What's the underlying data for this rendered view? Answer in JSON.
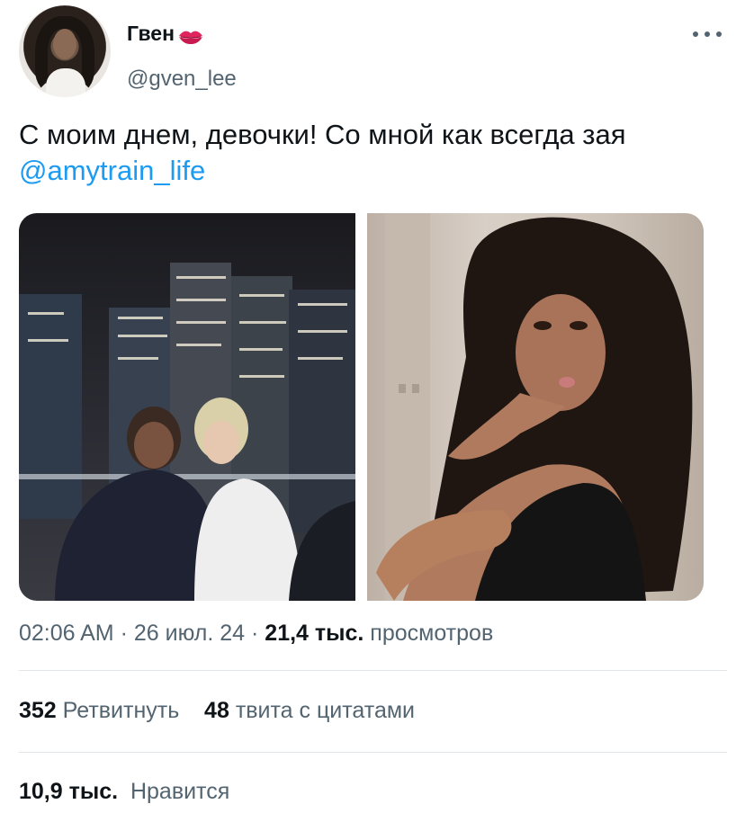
{
  "author": {
    "display_name": "Гвен",
    "handle": "@gven_lee",
    "name_emoji": "lips-kiss-icon"
  },
  "tweet": {
    "text_before_mention": "С моим днем, девочки! Со мной как всегда зая ",
    "mention": "@amytrain_life"
  },
  "media": [
    {
      "name": "photo-two-girls-city-night"
    },
    {
      "name": "photo-curly-hair-portrait"
    }
  ],
  "meta": {
    "time": "02:06 AM",
    "separator": " · ",
    "date": "26 июл. 24",
    "views_count": "21,4 тыс.",
    "views_label": "просмотров"
  },
  "stats": {
    "retweets_count": "352",
    "retweets_label": "Ретвитнуть",
    "quotes_count": "48",
    "quotes_label": "твита с цитатами",
    "likes_count": "10,9 тыс.",
    "likes_label": "Нравится"
  },
  "colors": {
    "text": "#0f1419",
    "secondary": "#536471",
    "link": "#1d9bf0",
    "divider": "#e1e6ea",
    "lips": "#e0245e"
  }
}
